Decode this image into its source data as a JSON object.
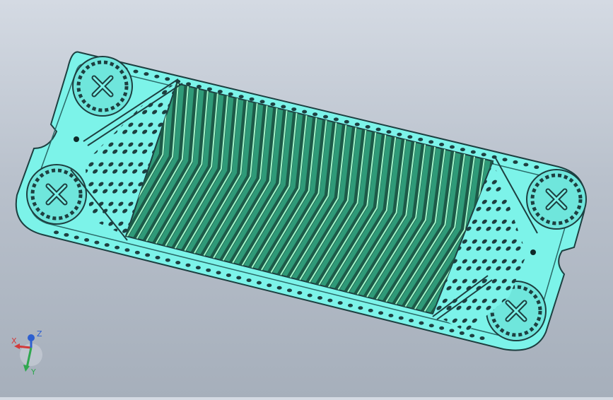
{
  "app": {
    "title": "",
    "background_top": "#d4dae3",
    "background_bottom": "#a6afbb"
  },
  "model": {
    "part": "plate-heat-exchanger-plate",
    "plate_color": "#7cf3e9",
    "plate_edge_color": "#1d3f40",
    "channel_color": "#2f9a78",
    "channel_ridge_color": "#9ff5c8"
  },
  "triad": {
    "x_label": "X",
    "y_label": "Y",
    "z_label": "Z",
    "x_color": "#d23a3a",
    "y_color": "#2fa84f",
    "z_color": "#2d5fd0"
  }
}
